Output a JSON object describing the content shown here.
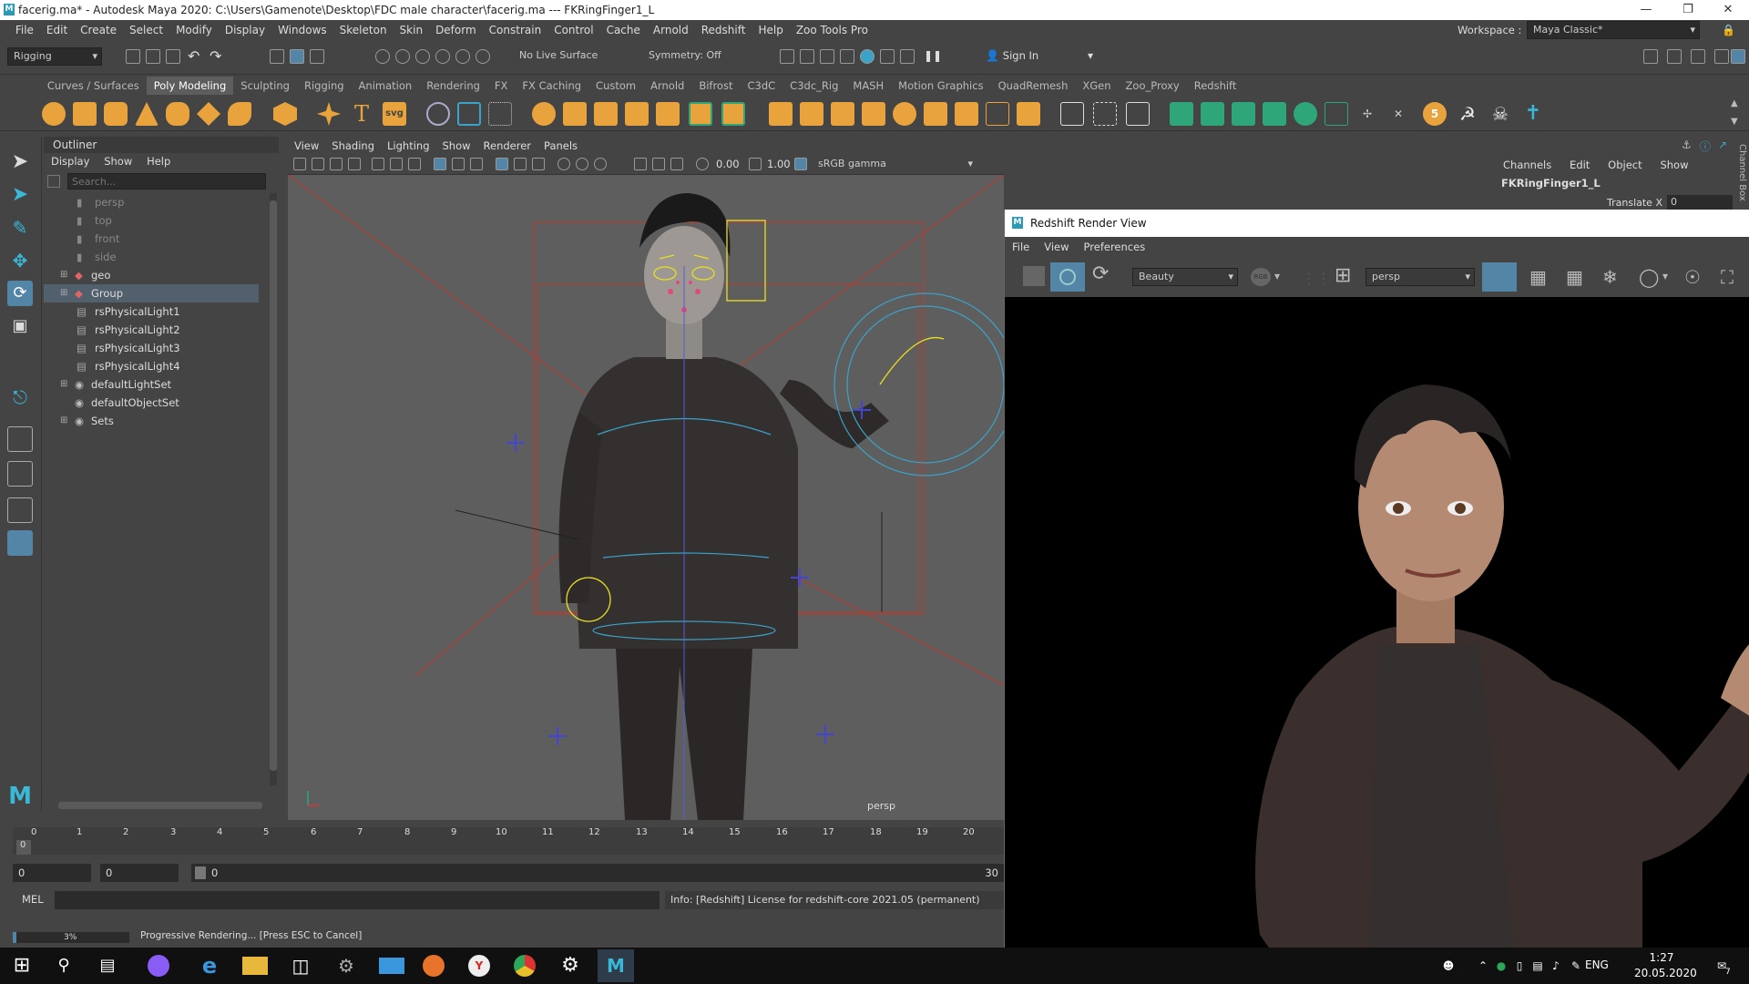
{
  "window": {
    "title": "facerig.ma* - Autodesk Maya 2020: C:\\Users\\Gamenote\\Desktop\\FDC male character\\facerig.ma  ---  FKRingFinger1_L"
  },
  "menubar": {
    "items": [
      "File",
      "Edit",
      "Create",
      "Select",
      "Modify",
      "Display",
      "Windows",
      "Skeleton",
      "Skin",
      "Deform",
      "Constrain",
      "Control",
      "Cache",
      "Arnold",
      "Redshift",
      "Help",
      "Zoo Tools Pro"
    ],
    "workspace_label": "Workspace :",
    "workspace_value": "Maya Classic*"
  },
  "statusline": {
    "menuset": "Rigging",
    "live_surface": "No Live Surface",
    "symmetry": "Symmetry: Off",
    "sign_in": "Sign In"
  },
  "shelf": {
    "tabs": [
      "Curves / Surfaces",
      "Poly Modeling",
      "Sculpting",
      "Rigging",
      "Animation",
      "Rendering",
      "FX",
      "FX Caching",
      "Custom",
      "Arnold",
      "Bifrost",
      "C3dC",
      "C3dc_Rig",
      "MASH",
      "Motion Graphics",
      "QuadRemesh",
      "XGen",
      "Zoo_Proxy",
      "Redshift"
    ],
    "active_tab": "Poly Modeling",
    "svg_label": "svg",
    "number_badge": "5"
  },
  "outliner": {
    "title": "Outliner",
    "menu": [
      "Display",
      "Show",
      "Help"
    ],
    "search_placeholder": "Search...",
    "items": [
      {
        "label": "persp",
        "dim": true
      },
      {
        "label": "top",
        "dim": true
      },
      {
        "label": "front",
        "dim": true
      },
      {
        "label": "side",
        "dim": true
      },
      {
        "label": "geo",
        "dim": false
      },
      {
        "label": "Group",
        "dim": false
      },
      {
        "label": "rsPhysicalLight1",
        "dim": false
      },
      {
        "label": "rsPhysicalLight2",
        "dim": false
      },
      {
        "label": "rsPhysicalLight3",
        "dim": false
      },
      {
        "label": "rsPhysicalLight4",
        "dim": false
      },
      {
        "label": "defaultLightSet",
        "dim": false
      },
      {
        "label": "defaultObjectSet",
        "dim": false
      },
      {
        "label": "Sets",
        "dim": false
      }
    ],
    "selected": "Group"
  },
  "viewport": {
    "menu": [
      "View",
      "Shading",
      "Lighting",
      "Show",
      "Renderer",
      "Panels"
    ],
    "exposure": "0.00",
    "gamma": "1.00",
    "colorspace": "sRGB gamma",
    "camera_label": "persp"
  },
  "channelbox": {
    "menu": [
      "Channels",
      "Edit",
      "Object",
      "Show"
    ],
    "object_name": "FKRingFinger1_L",
    "attr_label": "Translate X",
    "attr_value": "0",
    "side_tab": "Channel Box"
  },
  "renderview": {
    "title": "Redshift Render View",
    "menu": [
      "File",
      "View",
      "Preferences"
    ],
    "aov": "Beauty",
    "rgb": "RGB",
    "camera": "persp"
  },
  "timeline": {
    "ticks": [
      "0",
      "1",
      "2",
      "3",
      "4",
      "5",
      "6",
      "7",
      "8",
      "9",
      "10",
      "11",
      "12",
      "13",
      "14",
      "15",
      "16",
      "17",
      "18",
      "19",
      "20"
    ],
    "current_frame": "0",
    "range_start": "0",
    "range_inner_start": "0",
    "range_slider_start": "0",
    "range_end": "30"
  },
  "cmdline": {
    "lang": "MEL",
    "info": "Info:  [Redshift] License for redshift-core 2021.05 (permanent)"
  },
  "helpline": {
    "progress_pct": 0.03,
    "progress_text": "3%",
    "message": "Progressive Rendering... [Press ESC to Cancel]"
  },
  "taskbar": {
    "lang": "ENG",
    "time": "1:27",
    "date": "20.05.2020",
    "notif_count": "7"
  },
  "colors": {
    "maya_bg": "#444444",
    "viewport_bg": "#5e5e5e",
    "selection": "#52606e",
    "accent_blue": "#5285a6",
    "shelf_orange": "#e8a33c",
    "shelf_green": "#2ea67a",
    "skin": "#b58a72",
    "jacket": "#3a2f2d"
  }
}
